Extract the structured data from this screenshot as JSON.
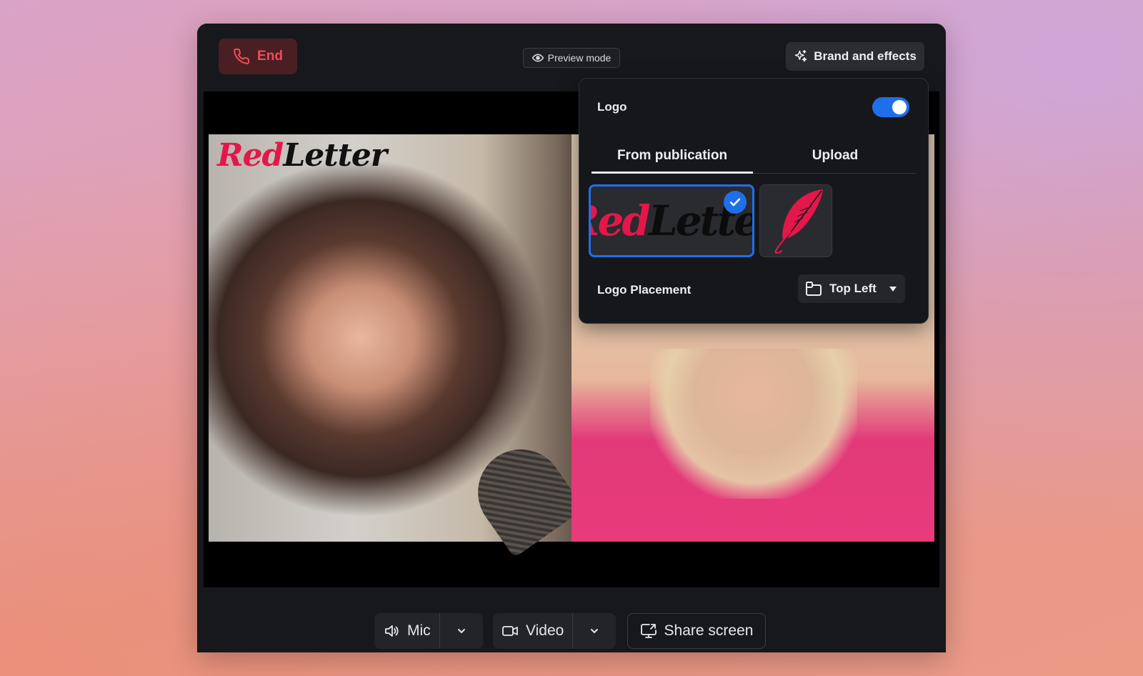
{
  "topbar": {
    "end_label": "End",
    "preview_label": "Preview mode",
    "brand_label": "Brand and effects"
  },
  "video": {
    "logo_red": "Red",
    "logo_black": "Letter"
  },
  "panel": {
    "logo_label": "Logo",
    "logo_enabled": true,
    "tabs": [
      {
        "label": "From publication",
        "active": true
      },
      {
        "label": "Upload",
        "active": false
      }
    ],
    "thumbnails": [
      {
        "name": "redletter-wordmark",
        "text_red": "Red",
        "text_black": "Letter",
        "selected": true
      },
      {
        "name": "feather-icon-logo",
        "selected": false
      }
    ],
    "placement_label": "Logo Placement",
    "placement_value": "Top Left"
  },
  "controls": {
    "mic_label": "Mic",
    "video_label": "Video",
    "share_label": "Share screen"
  },
  "colors": {
    "accent": "#1f6feb",
    "end_red": "#f24b57",
    "brand_red": "#e4174a"
  }
}
